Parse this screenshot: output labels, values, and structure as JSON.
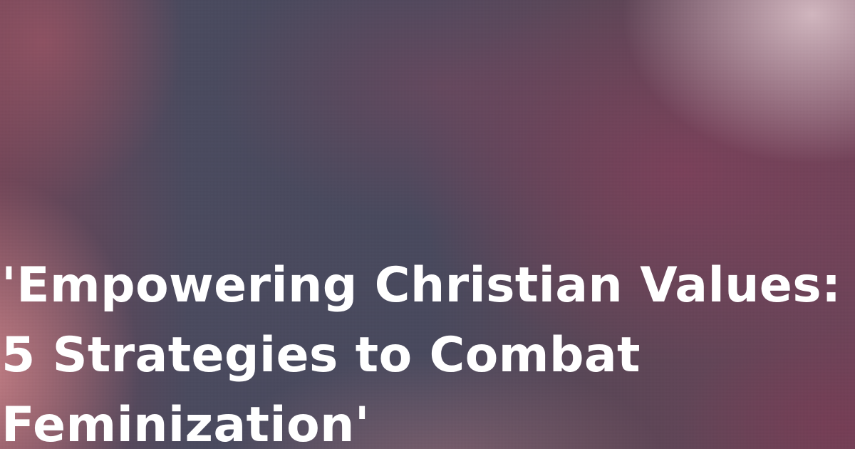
{
  "title": {
    "line1": "'Empowering Christian Values:",
    "line2": "5 Strategies to Combat",
    "line3": "Feminization'"
  },
  "colors": {
    "text": "#ffffff",
    "background_base": "#48495d",
    "accent_pink": "#c48086",
    "accent_plum": "#7e405a",
    "highlight_rose": "#d6bcc4"
  }
}
